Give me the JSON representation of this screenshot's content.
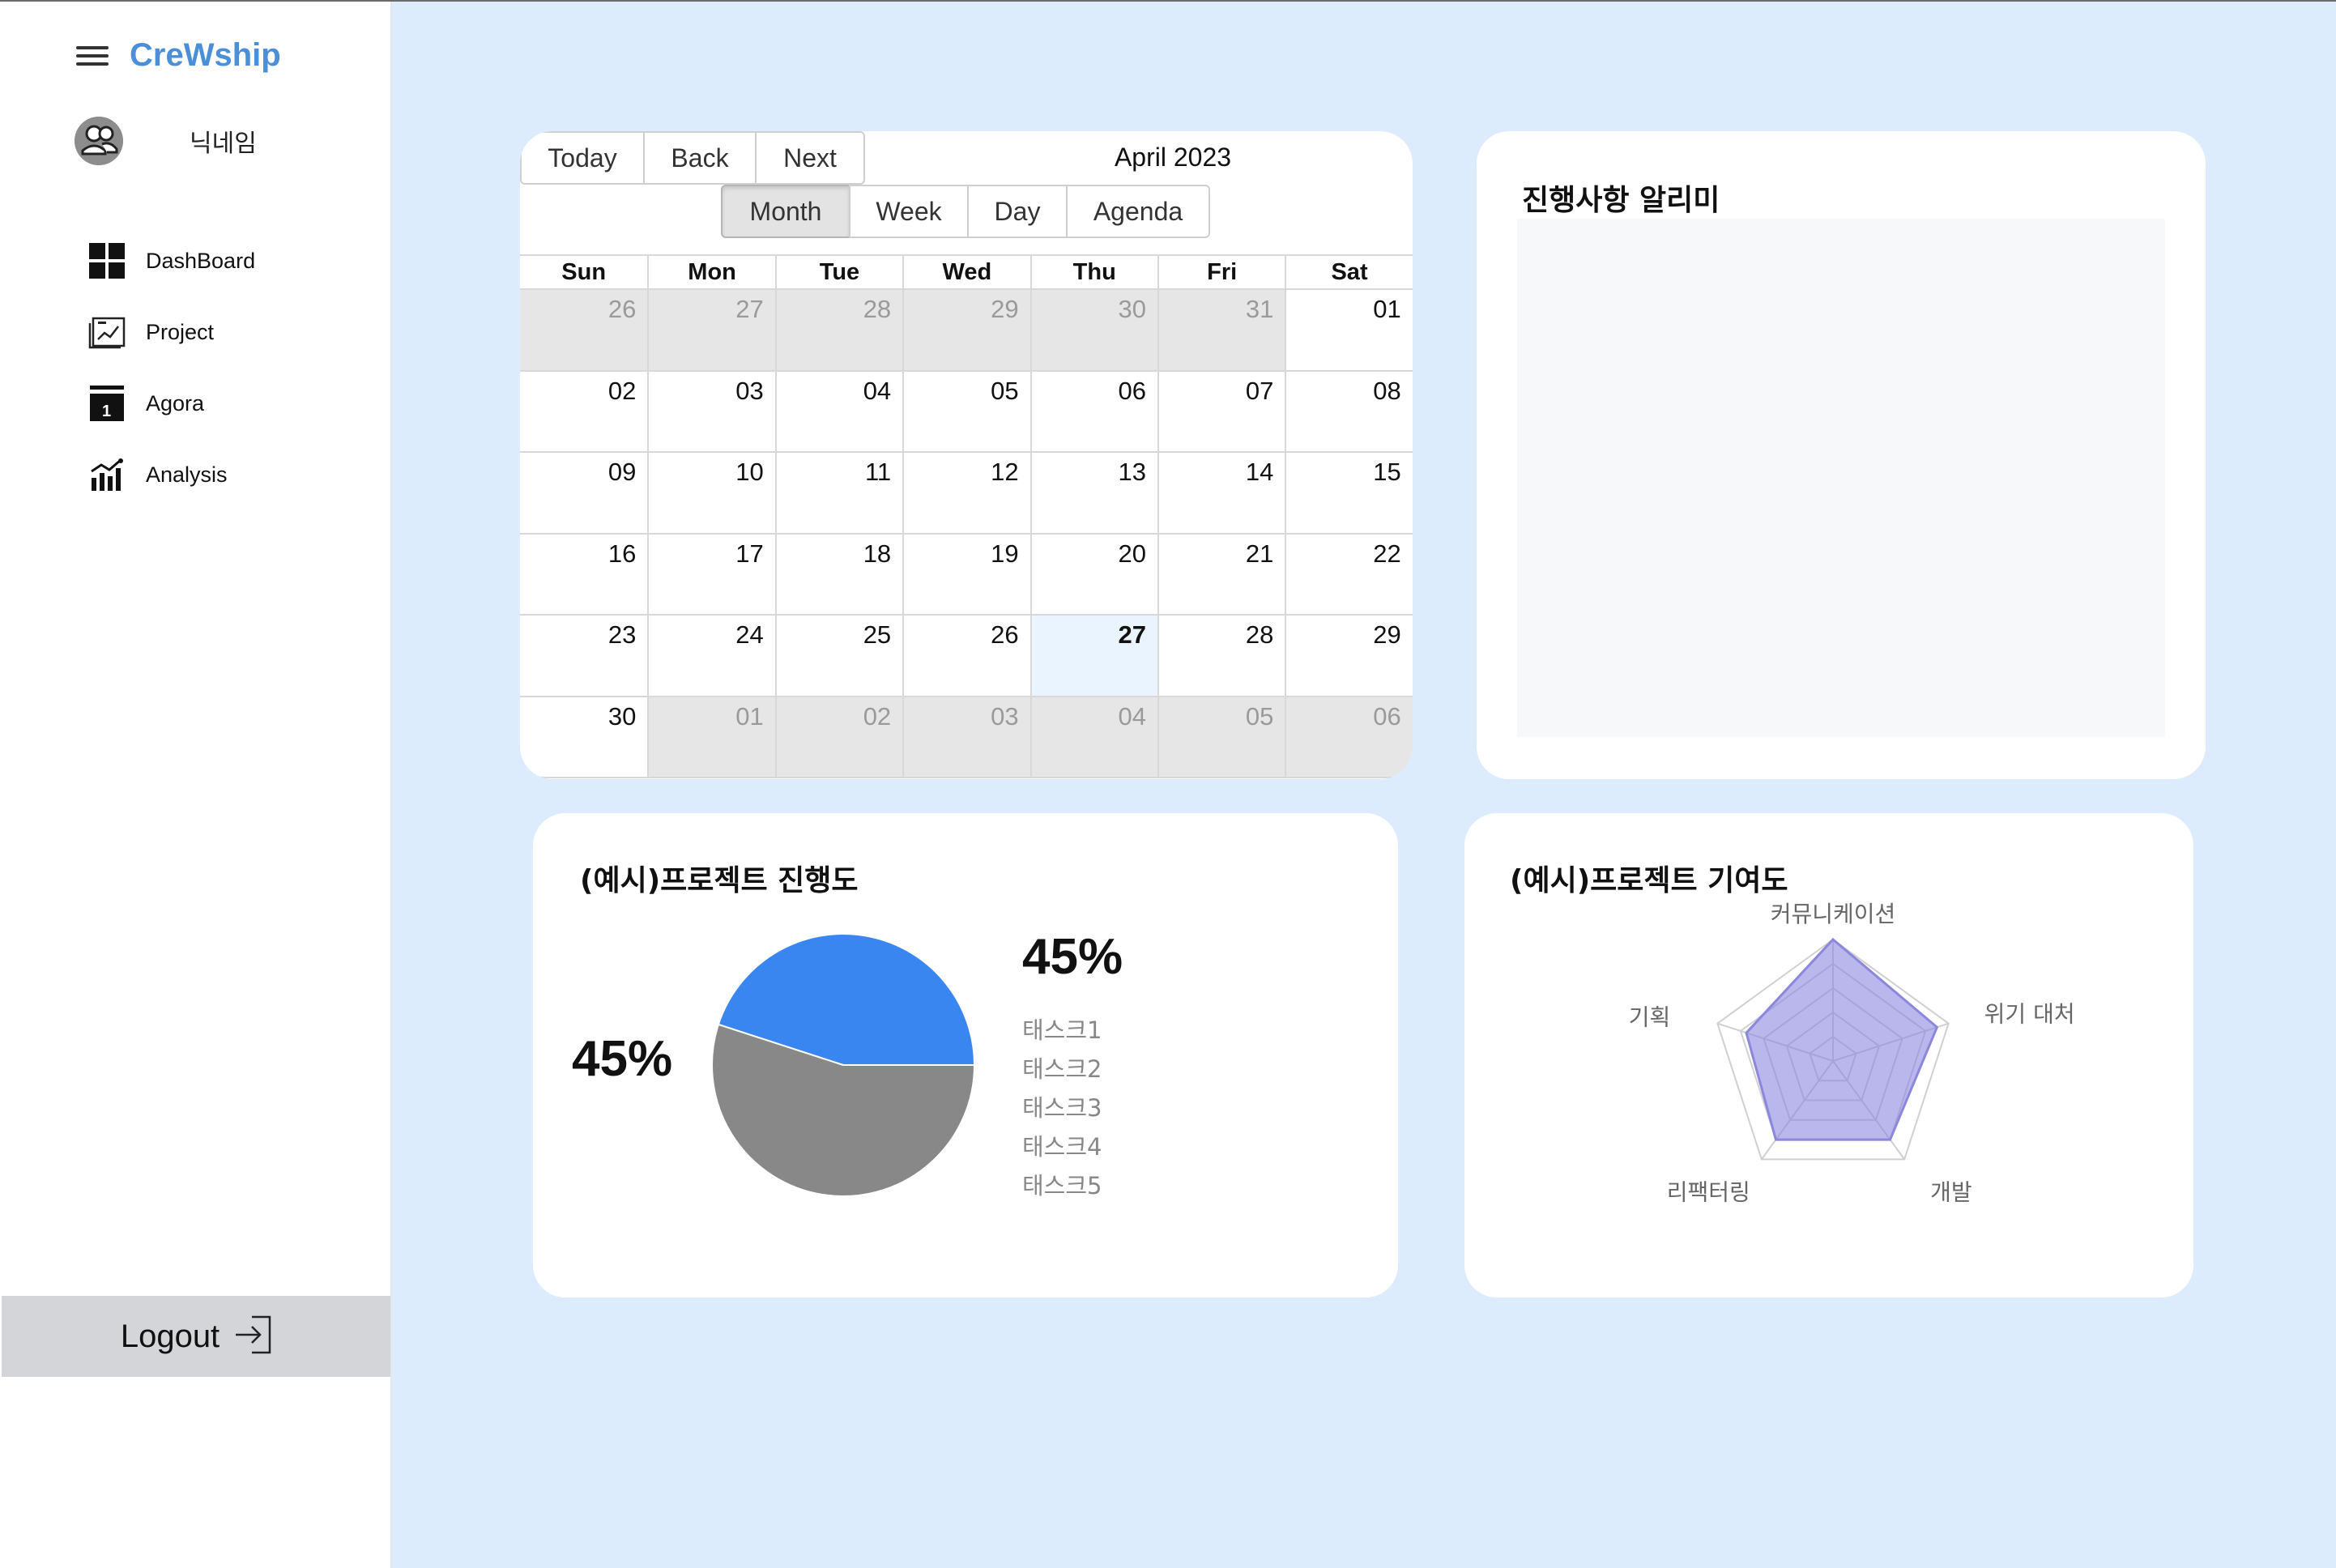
{
  "app": {
    "title": "CreWship"
  },
  "profile": {
    "nickname": "닉네임"
  },
  "nav": {
    "items": [
      {
        "label": "DashBoard",
        "icon": "dashboard-grid-icon"
      },
      {
        "label": "Project",
        "icon": "project-chart-icon"
      },
      {
        "label": "Agora",
        "icon": "calendar-icon"
      },
      {
        "label": "Analysis",
        "icon": "analytics-icon"
      }
    ]
  },
  "logout": {
    "label": "Logout",
    "icon": "logout-icon"
  },
  "calendar": {
    "nav_buttons": [
      "Today",
      "Back",
      "Next"
    ],
    "title": "April 2023",
    "view_buttons": [
      "Month",
      "Week",
      "Day",
      "Agenda"
    ],
    "active_view": "Month",
    "weekdays": [
      "Sun",
      "Mon",
      "Tue",
      "Wed",
      "Thu",
      "Fri",
      "Sat"
    ],
    "weeks": [
      [
        "26",
        "27",
        "28",
        "29",
        "30",
        "31",
        "01"
      ],
      [
        "02",
        "03",
        "04",
        "05",
        "06",
        "07",
        "08"
      ],
      [
        "09",
        "10",
        "11",
        "12",
        "13",
        "14",
        "15"
      ],
      [
        "16",
        "17",
        "18",
        "19",
        "20",
        "21",
        "22"
      ],
      [
        "23",
        "24",
        "25",
        "26",
        "27",
        "28",
        "29"
      ],
      [
        "30",
        "01",
        "02",
        "03",
        "04",
        "05",
        "06"
      ]
    ],
    "today": "27"
  },
  "notice": {
    "title": "진행사항 알리미"
  },
  "progress": {
    "title": "(예시)프로젝트 진행도",
    "percent_left": "45%",
    "percent_right": "45%",
    "legend": [
      "태스크1",
      "태스크2",
      "태스크3",
      "태스크4",
      "태스크5"
    ]
  },
  "contribution": {
    "title": "(예시)프로젝트 기여도"
  },
  "chart_data": [
    {
      "type": "pie",
      "title": "(예시)프로젝트 진행도",
      "slices": [
        {
          "value": 45,
          "color": "#3a86f0"
        },
        {
          "value": 55,
          "color": "#888888"
        }
      ],
      "legend": [
        "태스크1",
        "태스크2",
        "태스크3",
        "태스크4",
        "태스크5"
      ]
    },
    {
      "type": "radar",
      "title": "(예시)프로젝트 기여도",
      "axes": [
        "커뮤니케이션",
        "위기 대처",
        "개발",
        "리팩터링",
        "기획"
      ],
      "values": [
        1.0,
        0.9,
        0.8,
        0.8,
        0.75
      ],
      "max": 1.0,
      "color": "#8b87dd"
    }
  ]
}
